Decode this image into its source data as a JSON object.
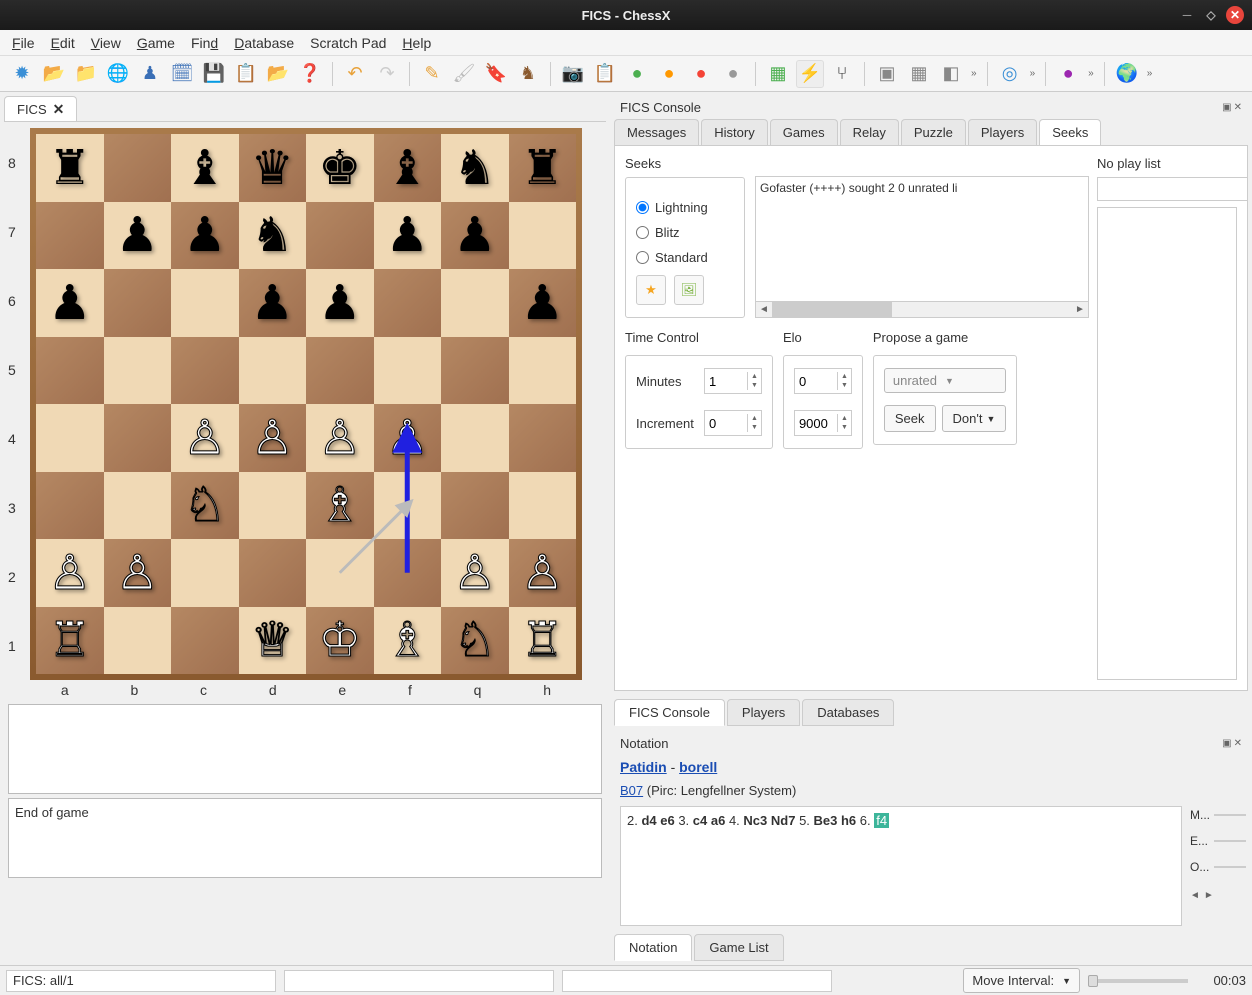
{
  "window": {
    "title": "FICS - ChessX"
  },
  "menu": {
    "file": "File",
    "edit": "Edit",
    "view": "View",
    "game": "Game",
    "find": "Find",
    "database": "Database",
    "scratchpad": "Scratch Pad",
    "help": "Help"
  },
  "left_tab": {
    "label": "FICS"
  },
  "board": {
    "ranks": [
      "8",
      "7",
      "6",
      "5",
      "4",
      "3",
      "2",
      "1"
    ],
    "files": [
      "a",
      "b",
      "c",
      "d",
      "e",
      "f",
      "q",
      "h"
    ],
    "position": {
      "a8": "br",
      "d8": "bq",
      "e8": "bk",
      "g8": "bn",
      "h8": "br",
      "c8": "bb",
      "f8": "bb",
      "b7": "bp",
      "c7": "bp",
      "d7": "bn",
      "f7": "bp",
      "g7": "bp",
      "a6": "bp",
      "d6": "bp",
      "e6": "bp",
      "h6": "bp",
      "c4": "wp",
      "d4": "wp",
      "e4": "wp",
      "f4": "wp",
      "c3": "wn",
      "e3": "wb",
      "a2": "wp",
      "b2": "wp",
      "g2": "wp",
      "h2": "wp",
      "a1": "wr",
      "d1": "wq",
      "e1": "wk",
      "f1": "wb",
      "g1": "wn",
      "h1": "wr"
    },
    "arrows": [
      {
        "from": "f2",
        "to": "f4",
        "color": "#2020e0"
      },
      {
        "from": "e2",
        "to": "f3",
        "color": "#bbb",
        "thin": true
      }
    ]
  },
  "endgame_text": "End of game",
  "fics_console": {
    "title": "FICS Console",
    "tabs": [
      "Messages",
      "History",
      "Games",
      "Relay",
      "Puzzle",
      "Players",
      "Seeks"
    ],
    "active_tab": 6,
    "seeks": {
      "label": "Seeks",
      "options": [
        "Lightning",
        "Blitz",
        "Standard"
      ],
      "selected": 0,
      "list_entry": "Gofaster (++++) sought 2 0 unrated li"
    },
    "noplay": {
      "label": "No play list"
    },
    "time_control": {
      "label": "Time Control",
      "minutes_label": "Minutes",
      "minutes": "1",
      "increment_label": "Increment",
      "increment": "0"
    },
    "elo": {
      "label": "Elo",
      "min": "0",
      "max": "9000"
    },
    "propose": {
      "label": "Propose a game",
      "rated": "unrated",
      "seek": "Seek",
      "dont": "Don't"
    }
  },
  "subtabs": [
    "FICS Console",
    "Players",
    "Databases"
  ],
  "subtabs_active": 0,
  "notation": {
    "title": "Notation",
    "white": "Patidin",
    "black": "borell",
    "eco": "B07",
    "opening": " (Pirc: Lengfellner System)",
    "moves_html": "2. <b>d4 e6</b> 3. <b>c4 a6</b> 4. <b>Nc3 Nd7</b> 5. <b>Be3 h6</b> 6. <span class='cur'>f4</span>",
    "side_labels": [
      "M...",
      "E...",
      "O..."
    ]
  },
  "bottom_tabs": [
    "Notation",
    "Game List"
  ],
  "bottom_active": 0,
  "status": {
    "left": "FICS: all/1",
    "move_interval": "Move Interval:",
    "time": "00:03"
  },
  "pieces_glyph": {
    "wk": "♔",
    "wq": "♕",
    "wr": "♖",
    "wb": "♗",
    "wn": "♘",
    "wp": "♙",
    "bk": "♚",
    "bq": "♛",
    "br": "♜",
    "bb": "♝",
    "bn": "♞",
    "bp": "♟"
  }
}
